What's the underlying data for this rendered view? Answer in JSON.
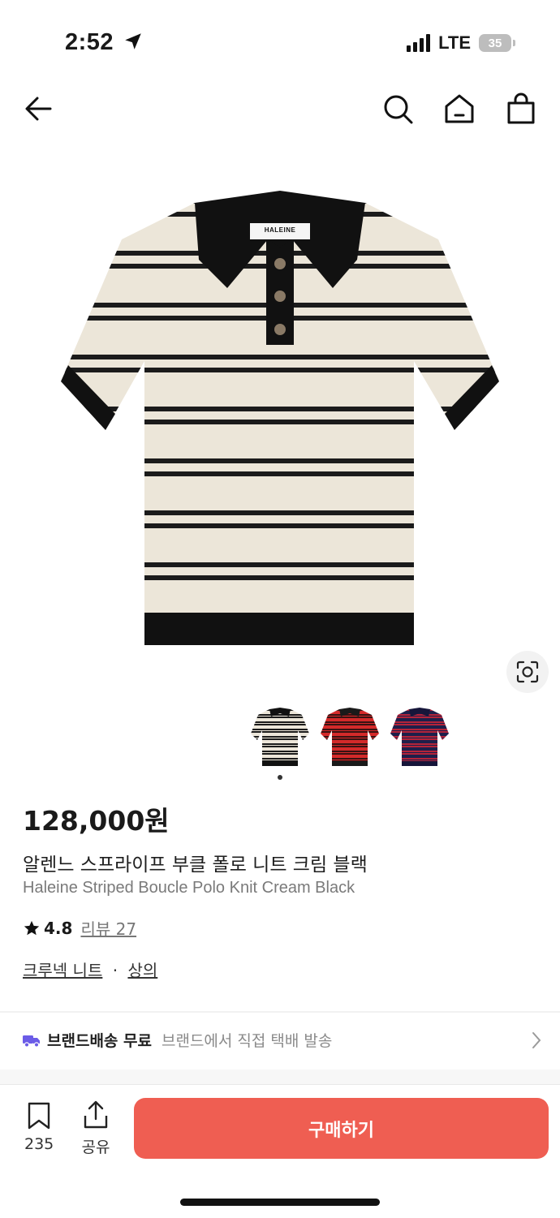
{
  "status_bar": {
    "time": "2:52",
    "network": "LTE",
    "battery": "35"
  },
  "nav": {
    "icons": [
      "back-arrow-icon",
      "search-icon",
      "home-icon",
      "shopping-bag-icon"
    ]
  },
  "product": {
    "price": "128,000원",
    "name_ko": "알렌느 스프라이프 부클 폴로 니트 크림 블랙",
    "name_en": "Haleine Striped Boucle Polo Knit Cream Black",
    "brand_label": "HALEINE",
    "rating": "4.8",
    "review_label": "리뷰 27",
    "category_1": "크루넥 니트",
    "category_separator": "·",
    "category_2": "상의",
    "color_options": [
      {
        "name": "cream-black",
        "body": "#ece6d9",
        "stripe": "#1b1b1b",
        "trim": "#111111"
      },
      {
        "name": "red",
        "body": "#d42a2a",
        "stripe": "#2a1010",
        "trim": "#1a1a1a"
      },
      {
        "name": "navy-red",
        "body": "#1e1f4a",
        "stripe": "#b3243a",
        "trim": "#16163a"
      }
    ]
  },
  "shipping": {
    "title": "브랜드배송 무료",
    "subtitle": "브랜드에서 직접 택배 발송"
  },
  "bottom_bar": {
    "bookmark_count": "235",
    "share_label": "공유",
    "buy_label": "구매하기"
  },
  "colors": {
    "accent": "#ef5e52",
    "shipping_icon": "#6b5ce7"
  }
}
